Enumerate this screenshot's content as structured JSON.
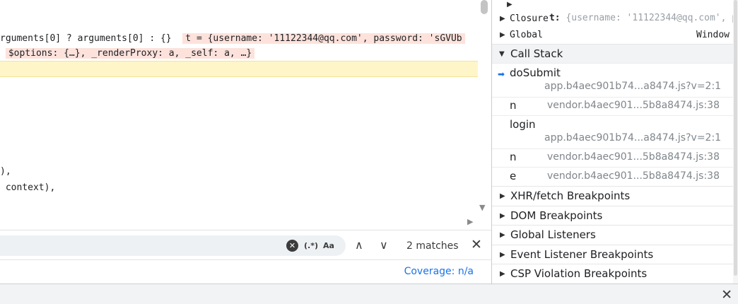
{
  "source": {
    "line1_code": "rguments[0] ? arguments[0] : {}",
    "line1_value": "t = {username: '11122344@qq.com', password: 'sGVUb",
    "line2_value": "$options: {…}, _renderProxy: a, _self: a, …}",
    "line3_code": "),",
    "line4_code": " context),"
  },
  "search": {
    "query": "",
    "clear_icon": "✕",
    "regex_label": "(.*)",
    "case_label": "Aa",
    "prev_icon": "∧",
    "next_icon": "∨",
    "match_count": "2 matches",
    "close_icon": "✕"
  },
  "footer": {
    "coverage": "Coverage: n/a"
  },
  "scope": {
    "t_key": "t:",
    "t_value": " {username: '11122344@qq.com', passw",
    "closure_label": "Closure",
    "global_label": "Global",
    "global_value": "Window"
  },
  "call_stack": {
    "title": "Call Stack",
    "frames": [
      {
        "name": "doSubmit",
        "location": "app.b4aec901b74...a8474.js?v=2:1"
      },
      {
        "name": "n",
        "location": "vendor.b4aec901...5b8a8474.js:38"
      },
      {
        "name": "login",
        "location": "app.b4aec901b74...a8474.js?v=2:1"
      },
      {
        "name": "n",
        "location": "vendor.b4aec901...5b8a8474.js:38"
      },
      {
        "name": "e",
        "location": "vendor.b4aec901...5b8a8474.js:38"
      }
    ]
  },
  "sections": [
    {
      "label": "XHR/fetch Breakpoints"
    },
    {
      "label": "DOM Breakpoints"
    },
    {
      "label": "Global Listeners"
    },
    {
      "label": "Event Listener Breakpoints"
    },
    {
      "label": "CSP Violation Breakpoints"
    }
  ],
  "drawer": {
    "close_icon": "✕"
  },
  "colors": {
    "accent": "#1a73e8",
    "exec_line": "#fef6c8",
    "inline_value_bg": "#fde2dc",
    "string_literal": "#c5221f"
  }
}
